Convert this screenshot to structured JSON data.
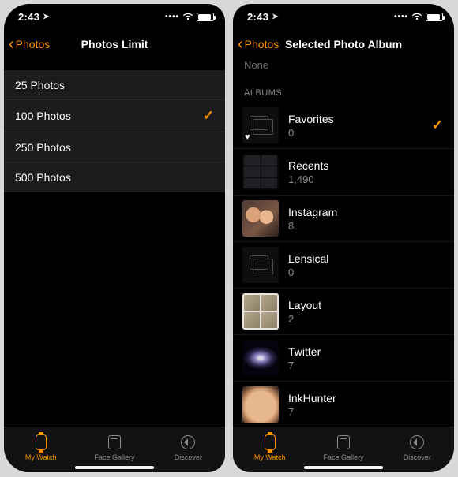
{
  "status": {
    "time": "2:43",
    "loc_arrow": "➤"
  },
  "left": {
    "back_label": "Photos",
    "title": "Photos Limit",
    "limits": [
      {
        "label": "25 Photos",
        "selected": false
      },
      {
        "label": "100 Photos",
        "selected": true
      },
      {
        "label": "250 Photos",
        "selected": false
      },
      {
        "label": "500 Photos",
        "selected": false
      }
    ]
  },
  "right": {
    "back_label": "Photos",
    "title": "Selected Photo Album",
    "none_label": "None",
    "section_header": "ALBUMS",
    "albums": [
      {
        "name": "Favorites",
        "count": "0",
        "thumb": "favorites",
        "selected": true
      },
      {
        "name": "Recents",
        "count": "1,490",
        "thumb": "recents",
        "selected": false
      },
      {
        "name": "Instagram",
        "count": "8",
        "thumb": "selfie",
        "selected": false
      },
      {
        "name": "Lensical",
        "count": "0",
        "thumb": "empty",
        "selected": false
      },
      {
        "name": "Layout",
        "count": "2",
        "thumb": "layout",
        "selected": false
      },
      {
        "name": "Twitter",
        "count": "7",
        "thumb": "galaxy",
        "selected": false
      },
      {
        "name": "InkHunter",
        "count": "7",
        "thumb": "hand",
        "selected": false
      }
    ]
  },
  "tabs": [
    {
      "label": "My Watch",
      "icon": "watch"
    },
    {
      "label": "Face Gallery",
      "icon": "gallery"
    },
    {
      "label": "Discover",
      "icon": "compass"
    }
  ],
  "active_tab": 0
}
